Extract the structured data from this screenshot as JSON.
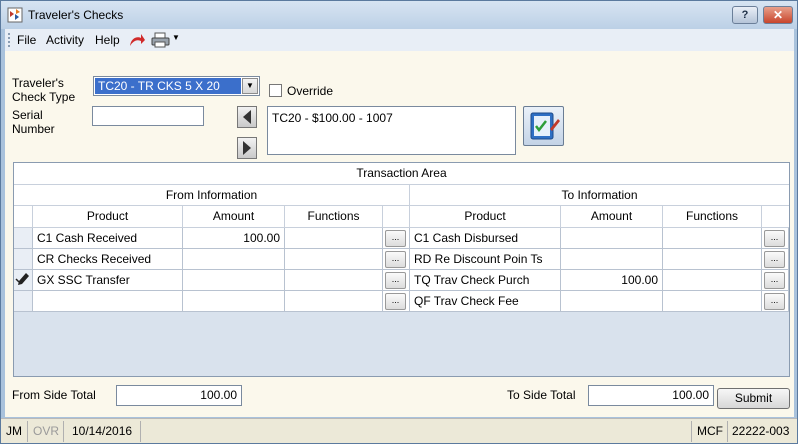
{
  "window": {
    "title": "Traveler's Checks",
    "help_label": "?",
    "close_label": "✕"
  },
  "menu": {
    "items": [
      "File",
      "Activity",
      "Help"
    ]
  },
  "form": {
    "check_type_label": "Traveler's\nCheck Type",
    "check_type_value": "TC20 - TR CKS 5 X 20",
    "override_label": "Override",
    "serial_label": "Serial\nNumber",
    "serial_value": "",
    "serial_list": [
      "TC20 - $100.00 - 1007"
    ]
  },
  "grid": {
    "title": "Transaction Area",
    "from_header": "From Information",
    "to_header": "To Information",
    "columns": {
      "product": "Product",
      "amount": "Amount",
      "functions": "Functions"
    },
    "rows": [
      {
        "from_product": "C1 Cash Received",
        "from_amount": "100.00",
        "to_product": "C1 Cash Disbursed",
        "to_amount": "",
        "marker": ""
      },
      {
        "from_product": "CR Checks Received",
        "from_amount": "",
        "to_product": "RD Re Discount Poin Ts",
        "to_amount": "",
        "marker": ""
      },
      {
        "from_product": "GX SSC Transfer",
        "from_amount": "",
        "to_product": "TQ Trav Check Purch",
        "to_amount": "100.00",
        "marker": "edit-pencil"
      },
      {
        "from_product": "",
        "from_amount": "",
        "to_product": "QF Trav Check Fee",
        "to_amount": "",
        "marker": ""
      }
    ],
    "func_button_label": "..."
  },
  "totals": {
    "from_label": "From Side Total",
    "from_value": "100.00",
    "to_label": "To Side Total",
    "to_value": "100.00",
    "submit_label": "Submit"
  },
  "status": {
    "user": "JM",
    "mode": "OVR",
    "date": "10/14/2016",
    "right1": "MCF",
    "right2": "22222-003"
  },
  "colors": {
    "selection": "#3b6fcb",
    "background": "#fbf8ec",
    "frame": "#a9c2dc"
  }
}
